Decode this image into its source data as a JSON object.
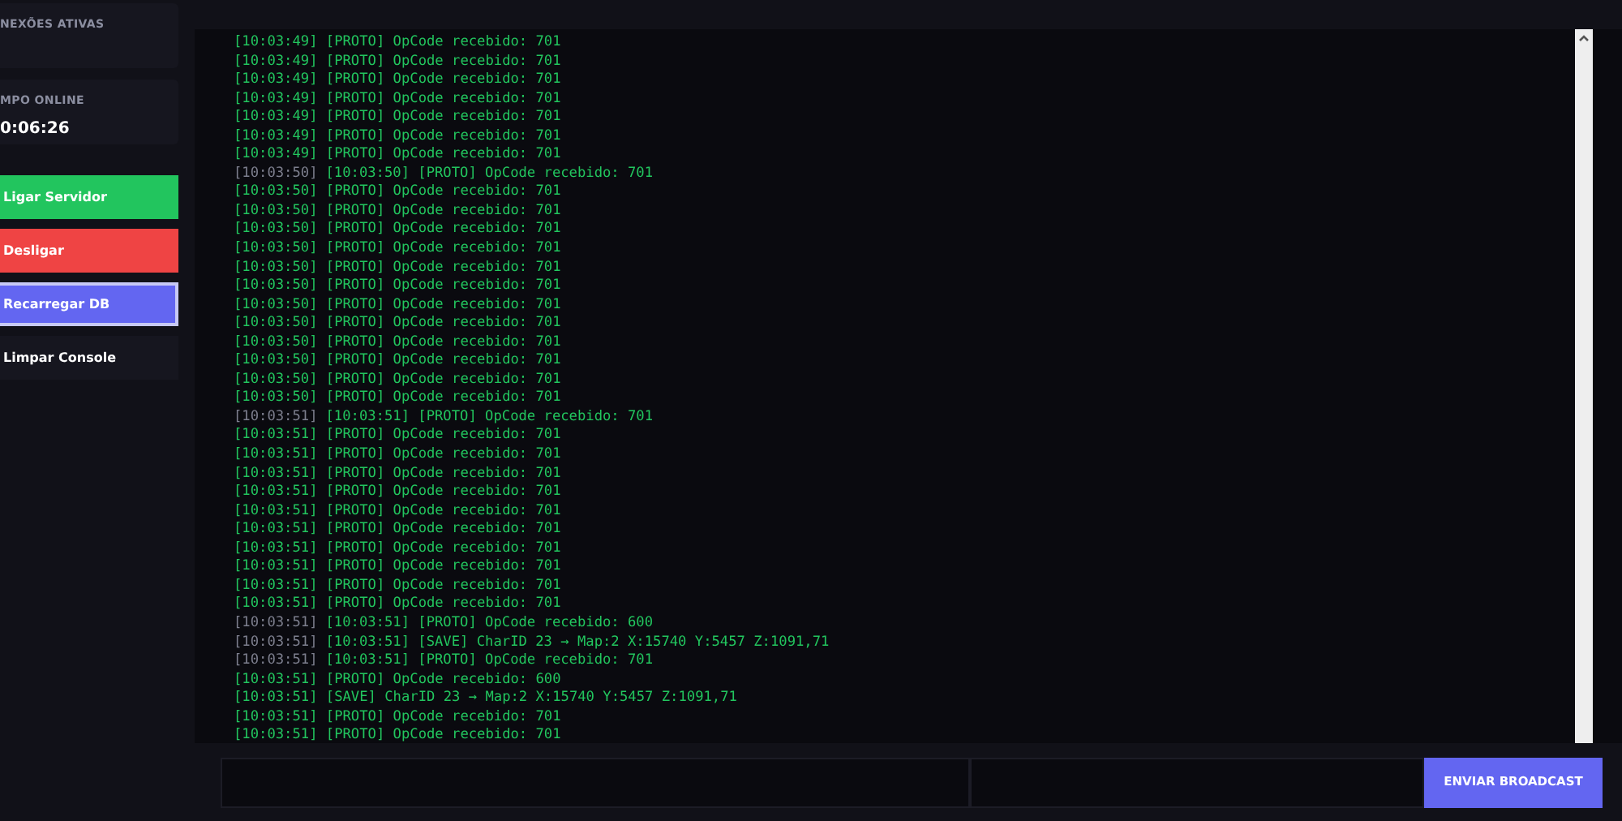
{
  "sidebar": {
    "stats": [
      {
        "label": "NEXÕES ATIVAS"
      },
      {
        "label": "MPO ONLINE",
        "value": "0:06:26"
      }
    ],
    "buttons": [
      {
        "label": "Ligar Servidor",
        "kind": "success",
        "focused": false
      },
      {
        "label": "Desligar",
        "kind": "danger",
        "focused": false
      },
      {
        "label": "Recarregar DB",
        "kind": "primary",
        "focused": true
      },
      {
        "label": "Limpar Console",
        "kind": "dark",
        "focused": false
      }
    ]
  },
  "console": {
    "lines": [
      {
        "text": "[10:03:49] [PROTO] OpCode recebido: 701"
      },
      {
        "text": "[10:03:49] [PROTO] OpCode recebido: 701"
      },
      {
        "text": "[10:03:49] [PROTO] OpCode recebido: 701"
      },
      {
        "text": "[10:03:49] [PROTO] OpCode recebido: 701"
      },
      {
        "text": "[10:03:49] [PROTO] OpCode recebido: 701"
      },
      {
        "text": "[10:03:49] [PROTO] OpCode recebido: 701"
      },
      {
        "text": "[10:03:49] [PROTO] OpCode recebido: 701"
      },
      {
        "prefix": "[10:03:50]",
        "text": "[10:03:50] [PROTO] OpCode recebido: 701"
      },
      {
        "text": "[10:03:50] [PROTO] OpCode recebido: 701"
      },
      {
        "text": "[10:03:50] [PROTO] OpCode recebido: 701"
      },
      {
        "text": "[10:03:50] [PROTO] OpCode recebido: 701"
      },
      {
        "text": "[10:03:50] [PROTO] OpCode recebido: 701"
      },
      {
        "text": "[10:03:50] [PROTO] OpCode recebido: 701"
      },
      {
        "text": "[10:03:50] [PROTO] OpCode recebido: 701"
      },
      {
        "text": "[10:03:50] [PROTO] OpCode recebido: 701"
      },
      {
        "text": "[10:03:50] [PROTO] OpCode recebido: 701"
      },
      {
        "text": "[10:03:50] [PROTO] OpCode recebido: 701"
      },
      {
        "text": "[10:03:50] [PROTO] OpCode recebido: 701"
      },
      {
        "text": "[10:03:50] [PROTO] OpCode recebido: 701"
      },
      {
        "text": "[10:03:50] [PROTO] OpCode recebido: 701"
      },
      {
        "prefix": "[10:03:51]",
        "text": "[10:03:51] [PROTO] OpCode recebido: 701"
      },
      {
        "text": "[10:03:51] [PROTO] OpCode recebido: 701"
      },
      {
        "text": "[10:03:51] [PROTO] OpCode recebido: 701"
      },
      {
        "text": "[10:03:51] [PROTO] OpCode recebido: 701"
      },
      {
        "text": "[10:03:51] [PROTO] OpCode recebido: 701"
      },
      {
        "text": "[10:03:51] [PROTO] OpCode recebido: 701"
      },
      {
        "text": "[10:03:51] [PROTO] OpCode recebido: 701"
      },
      {
        "text": "[10:03:51] [PROTO] OpCode recebido: 701"
      },
      {
        "text": "[10:03:51] [PROTO] OpCode recebido: 701"
      },
      {
        "text": "[10:03:51] [PROTO] OpCode recebido: 701"
      },
      {
        "text": "[10:03:51] [PROTO] OpCode recebido: 701"
      },
      {
        "prefix": "[10:03:51]",
        "text": "[10:03:51] [PROTO] OpCode recebido: 600"
      },
      {
        "prefix": "[10:03:51]",
        "text": "[10:03:51] [SAVE] CharID 23 → Map:2 X:15740 Y:5457 Z:1091,71"
      },
      {
        "prefix": "[10:03:51]",
        "text": "[10:03:51] [PROTO] OpCode recebido: 701"
      },
      {
        "text": "[10:03:51] [PROTO] OpCode recebido: 600"
      },
      {
        "text": "[10:03:51] [SAVE] CharID 23 → Map:2 X:15740 Y:5457 Z:1091,71"
      },
      {
        "text": "[10:03:51] [PROTO] OpCode recebido: 701"
      },
      {
        "text": "[10:03:51] [PROTO] OpCode recebido: 701"
      }
    ]
  },
  "broadcast": {
    "fields": [
      {
        "kind": "text"
      },
      {
        "kind": "text"
      }
    ],
    "button": "ENVIAR BROADCAST"
  }
}
